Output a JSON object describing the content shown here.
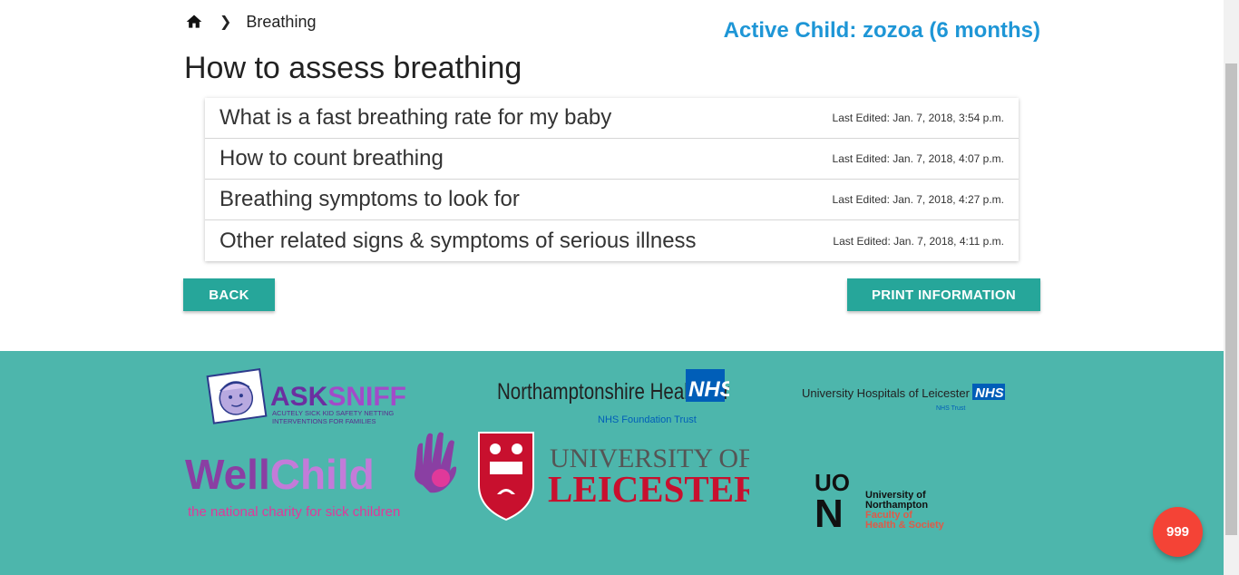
{
  "breadcrumb": {
    "current": "Breathing"
  },
  "active_child": "Active Child: zozoa (6 months)",
  "page_title": "How to assess breathing",
  "items": [
    {
      "title": "What is a fast breathing rate for my baby",
      "edited": "Last Edited: Jan. 7, 2018, 3:54 p.m."
    },
    {
      "title": "How to count breathing",
      "edited": "Last Edited: Jan. 7, 2018, 4:07 p.m."
    },
    {
      "title": "Breathing symptoms to look for",
      "edited": "Last Edited: Jan. 7, 2018, 4:27 p.m."
    },
    {
      "title": "Other related signs & symptoms of serious illness",
      "edited": "Last Edited: Jan. 7, 2018, 4:11 p.m."
    }
  ],
  "buttons": {
    "back": "BACK",
    "print": "PRINT INFORMATION",
    "emergency": "999"
  },
  "logos": {
    "asksniff": {
      "name": "ASKSNIFF",
      "ask": "ASK",
      "sniff": "SNIFF",
      "tag1": "ACUTELY SICK KID SAFETY NETTING",
      "tag2": "INTERVENTIONS FOR FAMILIES"
    },
    "northants": {
      "name": "Northamptonshire Healthcare",
      "nhs": "NHS",
      "trust": "NHS Foundation Trust"
    },
    "uhl": {
      "name": "University Hospitals of Leicester",
      "nhs": "NHS",
      "trust": "NHS Trust"
    },
    "wellchild": {
      "well": "Well",
      "child": "Child",
      "tagline": "the national charity for sick children"
    },
    "leicester": {
      "line1": "UNIVERSITY OF",
      "line2": "LEICESTER"
    },
    "northampton": {
      "mark_top": "UO",
      "mark_bottom": "N",
      "line1": "University of",
      "line2": "Northampton",
      "line3": "Faculty of",
      "line4": "Health & Society"
    }
  },
  "colors": {
    "accent": "#26a69a",
    "footer": "#4db6ac",
    "child_label": "#1e96d6",
    "emergency": "#f44336"
  }
}
